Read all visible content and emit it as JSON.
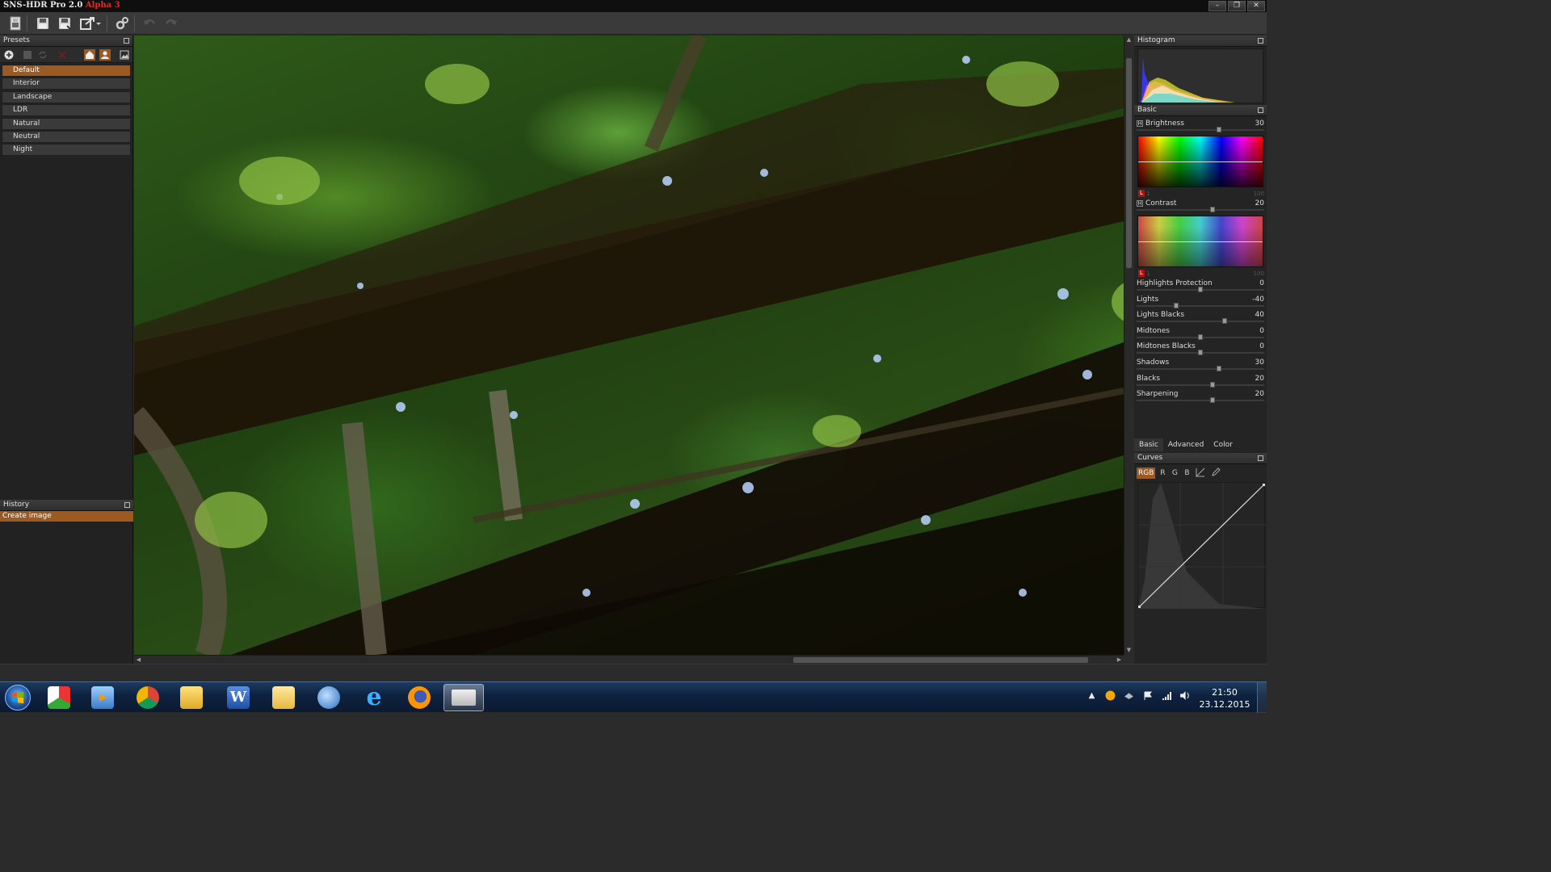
{
  "window": {
    "title_main": "SNS-HDR Pro 2.0",
    "title_accent": "Alpha 3",
    "controls": [
      "–",
      "❐",
      "✕"
    ]
  },
  "toolbar": {
    "icons": [
      "open-icon",
      "save-icon",
      "save-as-icon",
      "export-icon",
      "settings-icon",
      "undo-icon",
      "redo-icon"
    ]
  },
  "presets": {
    "title": "Presets",
    "items": [
      "Default",
      "Interior",
      "Landscape",
      "LDR",
      "Natural",
      "Neutral",
      "Night"
    ],
    "selected_index": 0
  },
  "history": {
    "title": "History",
    "items": [
      "Create image"
    ]
  },
  "right": {
    "histogram_title": "Histogram",
    "basic_title": "Basic",
    "brightness": {
      "label": "Brightness",
      "value": "30",
      "level": 0.65
    },
    "contrast": {
      "label": "Contrast",
      "value": "20",
      "level": 0.6
    },
    "spectrum_l": "L",
    "spectrum_scale_left": "1",
    "spectrum_scale_right": "100",
    "sliders": [
      {
        "label": "Highlights Protection",
        "value": "0",
        "level": 0.5
      },
      {
        "label": "Lights",
        "value": "-40",
        "level": 0.3
      },
      {
        "label": "Lights Blacks",
        "value": "40",
        "level": 0.7
      },
      {
        "label": "Midtones",
        "value": "0",
        "level": 0.5
      },
      {
        "label": "Midtones Blacks",
        "value": "0",
        "level": 0.5
      },
      {
        "label": "Shadows",
        "value": "30",
        "level": 0.65
      },
      {
        "label": "Blacks",
        "value": "20",
        "level": 0.6
      },
      {
        "label": "Sharpening",
        "value": "20",
        "level": 0.6
      }
    ],
    "tabs": [
      "Basic",
      "Advanced",
      "Color"
    ],
    "active_tab": 0,
    "curves_title": "Curves",
    "curve_channels": [
      "RGB",
      "R",
      "G",
      "B"
    ],
    "active_channel": 0
  },
  "taskbar": {
    "apps": [
      "presentation-app",
      "media-player",
      "chrome-browser",
      "file-explorer",
      "word-processor",
      "photo-viewer",
      "email-client",
      "internet-explorer",
      "firefox-browser",
      "sns-hdr-app"
    ],
    "active_app": 9,
    "time": "21:50",
    "date": "23.12.2015"
  },
  "colors": {
    "accent": "#9a5a22",
    "title_accent": "#e22a2a"
  }
}
